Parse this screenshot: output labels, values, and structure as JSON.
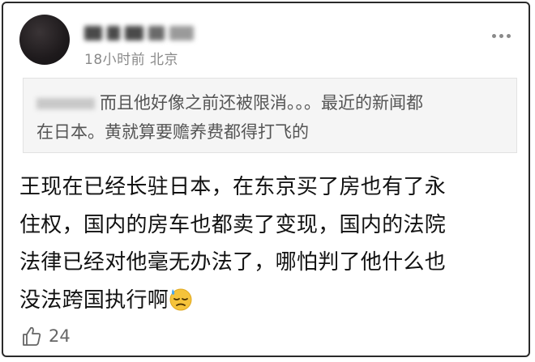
{
  "post": {
    "timestamp": "18小时前",
    "location": "北京",
    "quote_text_line1": "而且他好像之前还被限消。。。最近的新闻都",
    "quote_text_line2": "在日本。黄就算要赡养费都得打飞的",
    "body_lines": [
      "王现在已经长驻日本，在东京买了房也有了永",
      "住权，国内的房车也都卖了变现，国内的法院",
      "法律已经对他毫无办法了，哪怕判了他什么也",
      "没法跨国执行啊"
    ],
    "emoji": "sweat-downcast-face",
    "likes": "24"
  },
  "icons": {
    "more": "more-dots-icon",
    "like": "thumbs-up-icon"
  }
}
